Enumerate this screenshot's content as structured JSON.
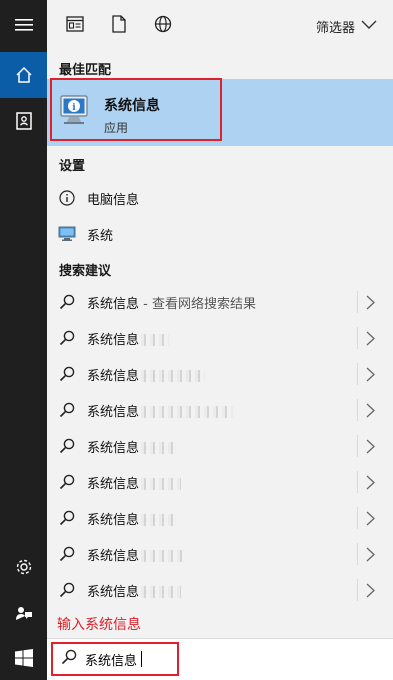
{
  "filters": {
    "label": "筛选器",
    "icons": [
      "apps-filter-icon",
      "document-filter-icon",
      "web-filter-icon"
    ]
  },
  "best_match": {
    "heading": "最佳匹配",
    "title": "系统信息",
    "subtitle": "应用"
  },
  "settings": {
    "heading": "设置",
    "items": [
      {
        "label": "电脑信息",
        "icon": "info-icon"
      },
      {
        "label": "系统",
        "icon": "monitor-icon"
      }
    ]
  },
  "suggestions": {
    "heading": "搜索建议",
    "items": [
      {
        "label": "系统信息",
        "suffix": " - 查看网络搜索结果"
      },
      {
        "label": "系统信息"
      },
      {
        "label": "系统信息"
      },
      {
        "label": "系统信息"
      },
      {
        "label": "系统信息"
      },
      {
        "label": "系统信息"
      },
      {
        "label": "系统信息"
      },
      {
        "label": "系统信息"
      },
      {
        "label": "系统信息"
      }
    ]
  },
  "hint": "输入系统信息",
  "search": {
    "value": "系统信息"
  },
  "colors": {
    "accent": "#0a5da6",
    "highlight": "#aed3f2",
    "annotation": "#e0202a"
  }
}
